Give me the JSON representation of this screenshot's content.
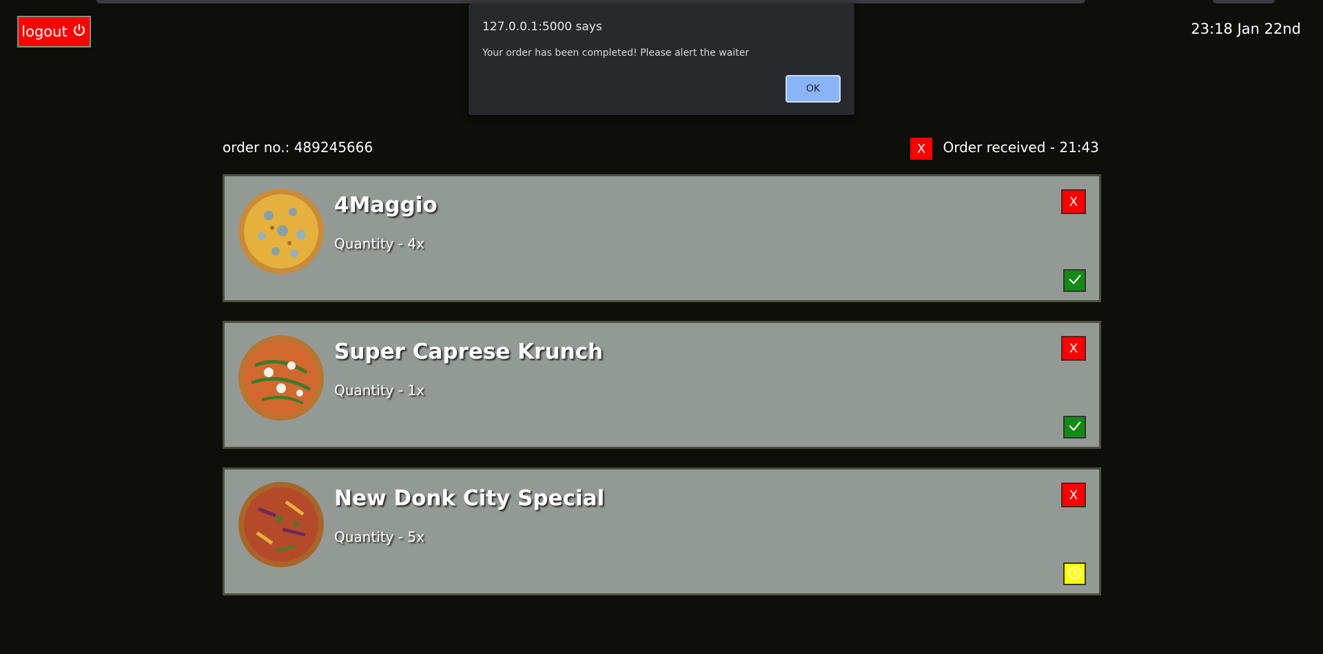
{
  "header": {
    "logout_label": "logout",
    "datetime": "23:18 Jan 22nd"
  },
  "order": {
    "number_label": "order no.: 489245666",
    "cancel_label": "X",
    "received_label": "Order received - 21:43"
  },
  "items": [
    {
      "name": "4Maggio",
      "quantity": "Quantity - 4x",
      "remove_label": "X",
      "status": "done"
    },
    {
      "name": "Super Caprese Krunch",
      "quantity": "Quantity - 1x",
      "remove_label": "X",
      "status": "done"
    },
    {
      "name": "New Donk City Special",
      "quantity": "Quantity - 5x",
      "remove_label": "X",
      "status": "pending"
    }
  ],
  "dialog": {
    "origin": "127.0.0.1:5000 says",
    "message": "Your order has been completed! Please alert the waiter",
    "ok_label": "OK"
  },
  "colors": {
    "background": "#0e0f0b",
    "danger": "#ff0000",
    "success": "#138a13",
    "pending": "#ffff00",
    "card": "#939a95"
  },
  "icons": {
    "logout": "power-icon",
    "done": "check-icon",
    "pending": "clock-icon"
  }
}
